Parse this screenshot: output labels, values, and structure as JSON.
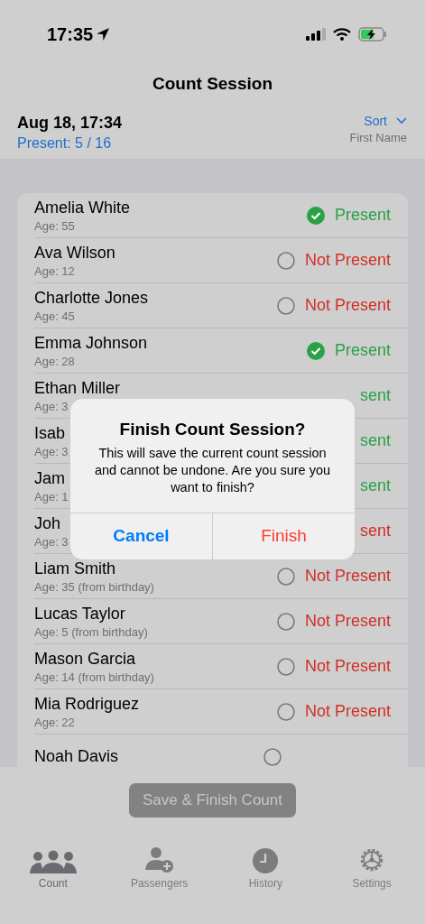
{
  "status_bar": {
    "time": "17:35"
  },
  "nav": {
    "title": "Count Session"
  },
  "header": {
    "date": "Aug 18, 17:34",
    "present": "Present: 5 / 16",
    "sort_label": "Sort",
    "sort_value": "First Name"
  },
  "passengers": [
    {
      "kind": "full",
      "name": "Amelia White",
      "age": "Age: 55",
      "present": true,
      "status": "Present"
    },
    {
      "kind": "full",
      "name": "Ava Wilson",
      "age": "Age: 12",
      "present": false,
      "status": "Not Present"
    },
    {
      "kind": "full",
      "name": "Charlotte Jones",
      "age": "Age: 45",
      "present": false,
      "status": "Not Present"
    },
    {
      "kind": "full",
      "name": "Emma Johnson",
      "age": "Age: 28",
      "present": true,
      "status": "Present"
    },
    {
      "kind": "covered",
      "name": "Ethan Miller",
      "age": "Age: 3",
      "present": true,
      "status": "sent"
    },
    {
      "kind": "covered",
      "name": "Isab",
      "age": "Age: 3",
      "present": true,
      "status": "sent"
    },
    {
      "kind": "covered",
      "name": "Jam",
      "age": "Age: 1",
      "present": true,
      "status": "sent"
    },
    {
      "kind": "covered",
      "name": "Joh",
      "age": "Age: 3",
      "present": false,
      "status": "sent"
    },
    {
      "kind": "full",
      "name": "Liam Smith",
      "age": "Age: 35 (from birthday)",
      "present": false,
      "status": "Not Present"
    },
    {
      "kind": "full",
      "name": "Lucas Taylor",
      "age": "Age: 5 (from birthday)",
      "present": false,
      "status": "Not Present"
    },
    {
      "kind": "full",
      "name": "Mason Garcia",
      "age": "Age: 14 (from birthday)",
      "present": false,
      "status": "Not Present"
    },
    {
      "kind": "full",
      "name": "Mia Rodriguez",
      "age": "Age: 22",
      "present": false,
      "status": "Not Present"
    },
    {
      "kind": "cut",
      "name": "Noah Davis",
      "present": false
    }
  ],
  "finish_button": {
    "label": "Save & Finish Count",
    "disabled": true
  },
  "tab_bar": [
    {
      "kind": "count",
      "label": "Count",
      "selected": true
    },
    {
      "kind": "passengers",
      "label": "Passengers",
      "selected": false
    },
    {
      "kind": "history",
      "label": "History",
      "selected": false
    },
    {
      "kind": "settings",
      "label": "Settings",
      "selected": false
    }
  ],
  "alert": {
    "title": "Finish Count Session?",
    "message": "This will save the current count session and cannot be undone. Are you sure you want to finish?",
    "buttons": [
      {
        "kind": "cancel",
        "label": "Cancel"
      },
      {
        "kind": "destructive",
        "label": "Finish"
      }
    ]
  }
}
